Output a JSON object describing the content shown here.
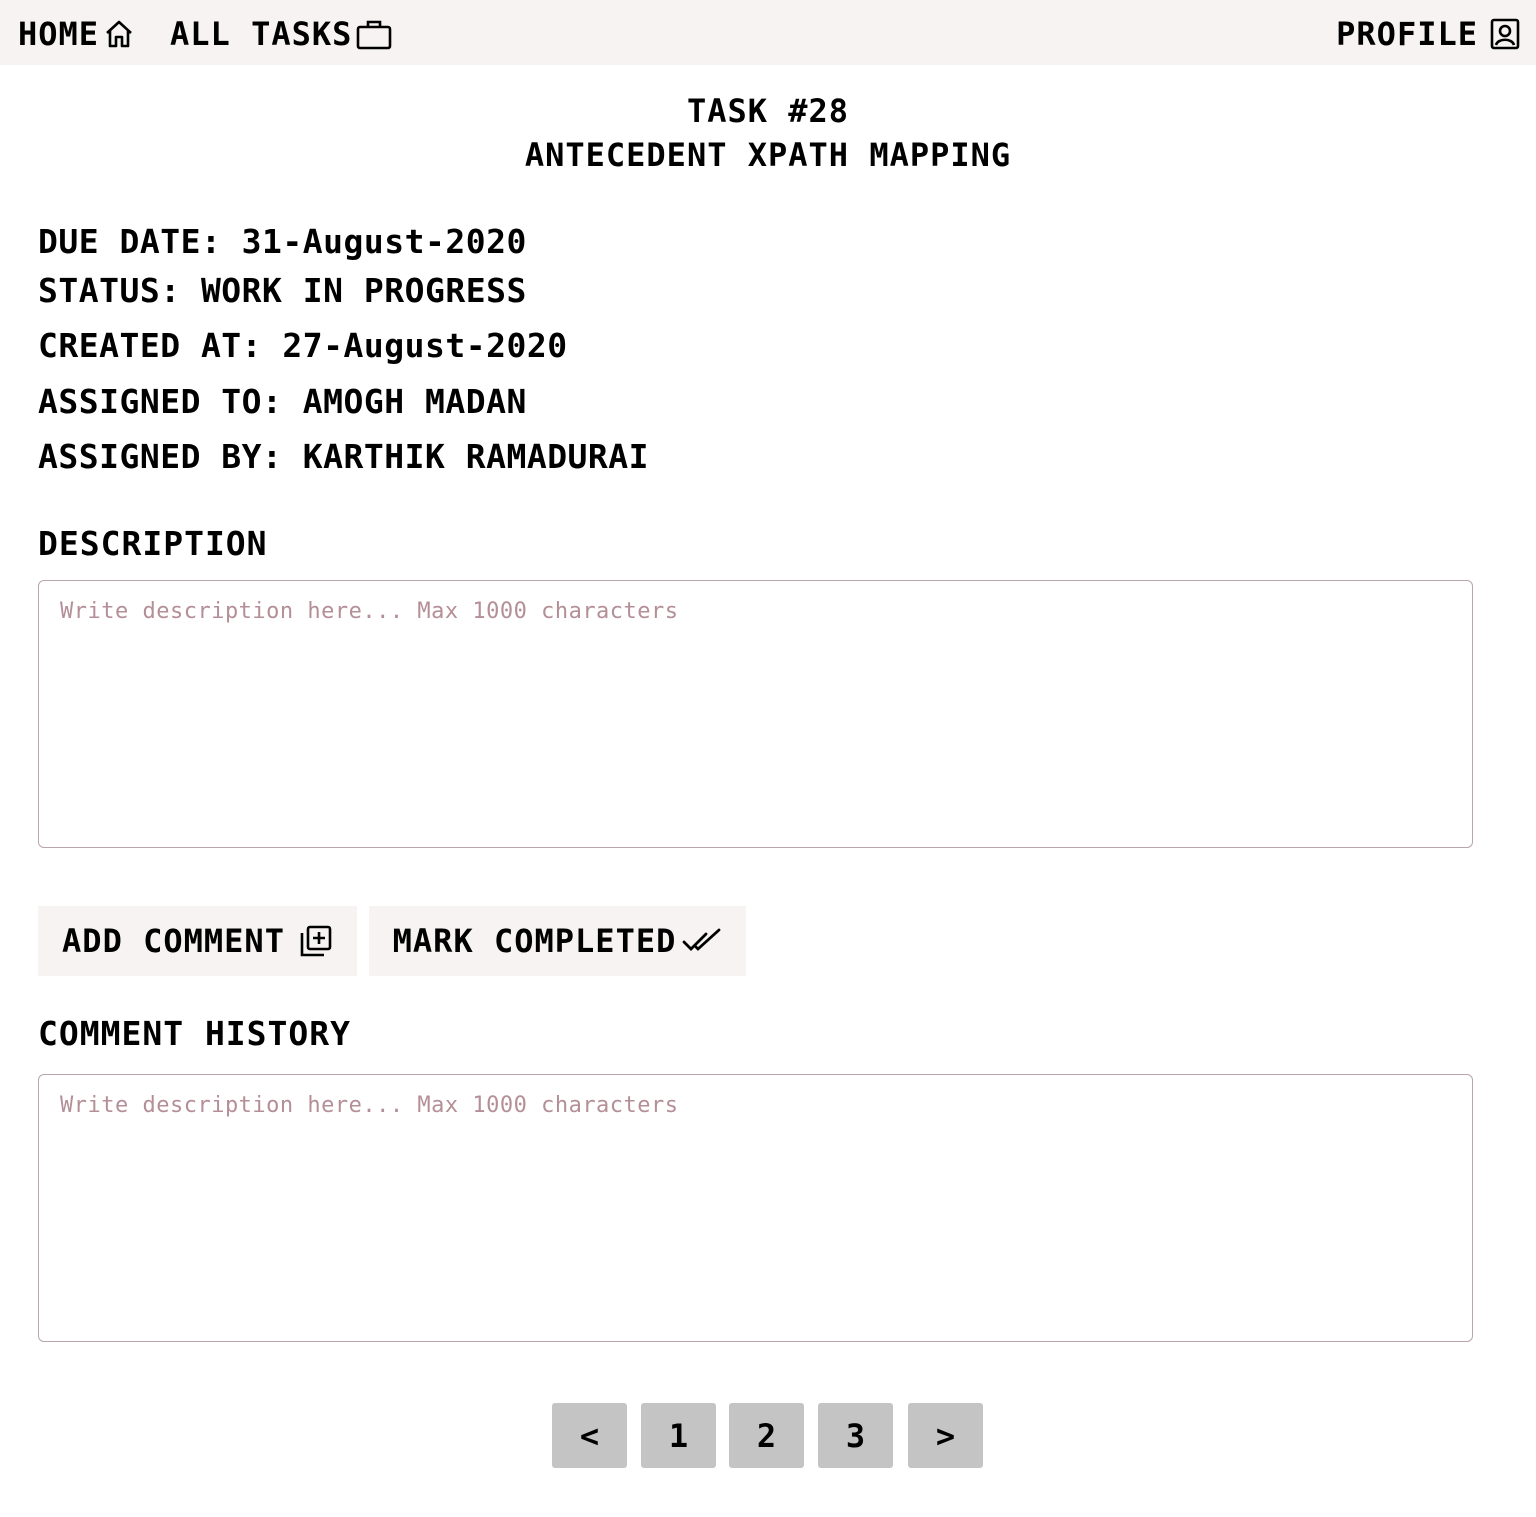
{
  "nav": {
    "home_label": "HOME",
    "home_icon": "home-icon",
    "tasks_label": "ALL TASKS",
    "tasks_icon": "briefcase-icon",
    "profile_label": "PROFILE",
    "profile_icon": "person-badge-icon"
  },
  "task": {
    "number": "TASK #28",
    "name": "ANTECEDENT XPATH MAPPING",
    "due_date": "DUE DATE: 31-August-2020",
    "status": "STATUS: WORK IN PROGRESS",
    "created_at": "CREATED AT: 27-August-2020",
    "assigned_to": "ASSIGNED TO: AMOGH MADAN",
    "assigned_by": "ASSIGNED BY: KARTHIK RAMADURAI"
  },
  "description": {
    "label": "DESCRIPTION",
    "placeholder": "Write description here... Max 1000 characters",
    "value": ""
  },
  "actions": {
    "add_comment_label": "ADD COMMENT",
    "add_comment_icon": "add-box-icon",
    "mark_completed_label": "MARK COMPLETED",
    "mark_completed_icon": "double-check-icon"
  },
  "comment_history": {
    "label": "COMMENT HISTORY",
    "placeholder": "Write description here... Max 1000 characters",
    "value": ""
  },
  "pagination": {
    "prev": "<",
    "pages": [
      "1",
      "2",
      "3"
    ],
    "next": ">"
  },
  "colors": {
    "topbar_bg": "#f6f3f2",
    "button_bg": "#f6f3f2",
    "page_button_bg": "#c4c4c4",
    "placeholder": "#b48f97",
    "textarea_border": "#b8a6ac"
  }
}
